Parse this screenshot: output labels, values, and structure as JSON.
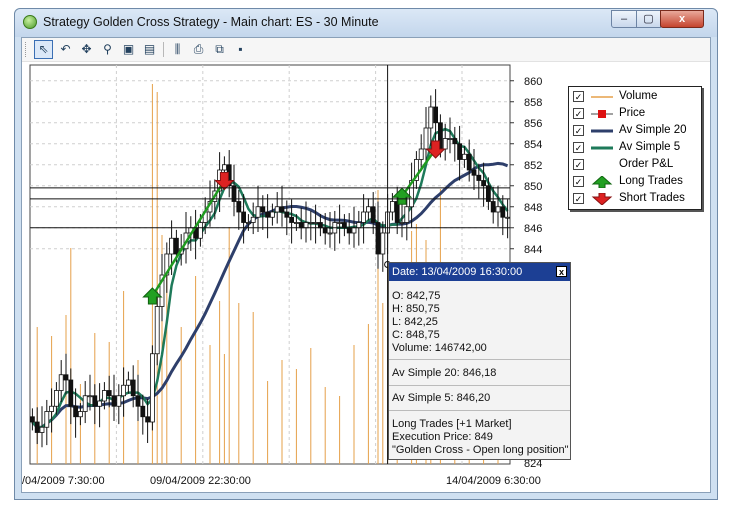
{
  "window": {
    "title": "Strategy Golden Cross Strategy - Main chart: ES - 30 Minute",
    "controls": {
      "minimize": "–",
      "maximize": "▢",
      "close": "x"
    }
  },
  "toolbar": {
    "buttons": [
      {
        "name": "pointer",
        "glyph": "⇖"
      },
      {
        "name": "undo",
        "glyph": "↶"
      },
      {
        "name": "pan",
        "glyph": "✥"
      },
      {
        "name": "zoom",
        "glyph": "⚲"
      },
      {
        "name": "zoom-area",
        "glyph": "▣"
      },
      {
        "name": "properties",
        "glyph": "▤"
      },
      {
        "name": "indicators",
        "glyph": "⫼"
      },
      {
        "name": "print",
        "glyph": "⎙"
      },
      {
        "name": "copy",
        "glyph": "⧉"
      },
      {
        "name": "save",
        "glyph": "▪"
      }
    ]
  },
  "chart_data": {
    "type": "candlestick",
    "symbol": "ES",
    "timeframe": "30 Minute",
    "y_ticks": [
      844,
      846,
      848,
      850,
      852,
      854,
      856,
      858,
      860
    ],
    "ylim": [
      823.5,
      861.5
    ],
    "x_tick_labels": [
      "/04/2009 7:30:00",
      "09/04/2009 22:30:00",
      "14/04/2009 6:30:00"
    ],
    "partial_tick_label": "824",
    "close_prices": [
      827.5,
      826.5,
      827,
      828.5,
      829,
      830.5,
      832,
      831.5,
      829,
      828,
      828.5,
      830,
      830,
      829,
      829.5,
      830.5,
      830,
      829,
      830,
      831,
      831.5,
      830,
      829,
      828,
      827.5,
      834,
      838.5,
      841.5,
      843.5,
      845,
      843.5,
      844,
      845.5,
      846,
      845,
      846.5,
      847.5,
      848.5,
      849.5,
      851.5,
      852,
      850,
      848.5,
      847.5,
      846.5,
      846.5,
      847,
      848,
      847.5,
      847,
      847.5,
      848,
      847.5,
      847,
      846.5,
      846.5,
      846,
      846.5,
      846.5,
      846.5,
      846,
      845.5,
      845.5,
      846.5,
      846.5,
      846,
      845.5,
      846,
      846.5,
      847.5,
      848,
      846.5,
      843.5,
      845.5,
      847.5,
      848.5,
      846.5,
      846.5,
      848,
      850.5,
      852.5,
      853.5,
      855.5,
      857.5,
      856,
      853.5,
      854.5,
      854.5,
      854,
      852.5,
      853,
      851.5,
      851,
      850.5,
      850,
      848.5,
      847.5,
      848,
      847,
      847
    ],
    "series": [
      {
        "name": "Volume",
        "color": "#e5a04a"
      },
      {
        "name": "Price",
        "color": "#222222"
      },
      {
        "name": "Av Simple 20",
        "color": "#2e3f6b"
      },
      {
        "name": "Av Simple 5",
        "color": "#1e7a5a"
      },
      {
        "name": "Order P&L",
        "color": "#2a9a2a"
      }
    ],
    "trades": [
      {
        "type": "long",
        "entry_bar": 25,
        "entry_price": 839.5,
        "exit_bar": 40,
        "exit_price": 850.5
      },
      {
        "type": "long",
        "entry_bar": 77,
        "entry_price": 849,
        "exit_bar": 84,
        "exit_price": 853.5
      }
    ],
    "short_markers": [
      {
        "bar": 40,
        "price": 850.5
      },
      {
        "bar": 84,
        "price": 853.5
      }
    ],
    "crosshair": {
      "bar": 74,
      "price": 848.75
    }
  },
  "legend": {
    "items": [
      {
        "label": "Volume",
        "checked": true,
        "symbol": "volume"
      },
      {
        "label": "Price",
        "checked": true,
        "symbol": "price"
      },
      {
        "label": "Av Simple 20",
        "checked": true,
        "symbol": "sma20"
      },
      {
        "label": "Av Simple 5",
        "checked": true,
        "symbol": "sma5"
      },
      {
        "label": "Order P&L",
        "checked": true,
        "symbol": "none"
      },
      {
        "label": "Long Trades",
        "checked": true,
        "symbol": "long-arrow"
      },
      {
        "label": "Short Trades",
        "checked": true,
        "symbol": "short-arrow"
      }
    ]
  },
  "tooltip": {
    "date": "Date: 13/04/2009 16:30:00",
    "open": "O:   842,75",
    "high": "H:   850,75",
    "low": "L:   842,25",
    "close": "C:   848,75",
    "volume": "Volume:   146742,00",
    "sma20": "Av Simple 20:   846,18",
    "sma5": "Av Simple 5:   846,20",
    "trade": "Long Trades [+1 Market]",
    "exec": "Execution Price: 849",
    "signal": "\"Golden Cross - Open long position\"",
    "close_glyph": "x"
  }
}
